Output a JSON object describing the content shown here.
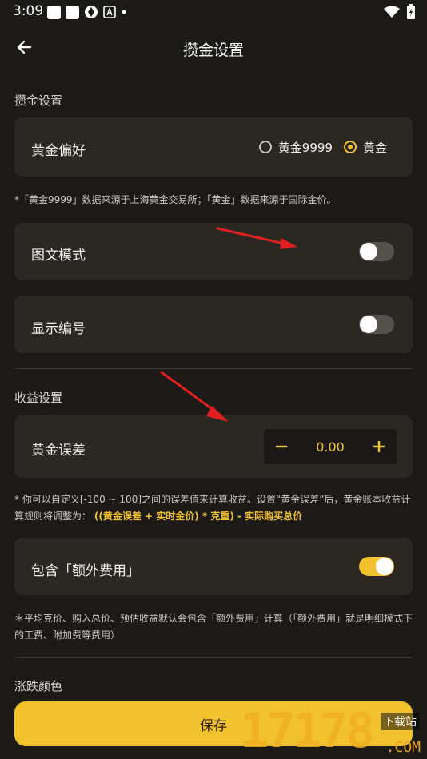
{
  "status_bar": {
    "time": "3:09"
  },
  "header": {
    "title": "攒金设置"
  },
  "section_zanjin": {
    "label": "攒金设置"
  },
  "gold_preference": {
    "label": "黄金偏好",
    "options": [
      "黄金9999",
      "黄金"
    ],
    "selected": "黄金"
  },
  "gold_note": "*「黄金9999」数据来源于上海黄金交易所；「黄金」数据来源于国际金价。",
  "image_text_mode": {
    "label": "图文模式",
    "on": false
  },
  "show_number": {
    "label": "显示编号",
    "on": false
  },
  "section_income": {
    "label": "收益设置"
  },
  "gold_error": {
    "label": "黄金误差",
    "value": "0.00"
  },
  "error_note": {
    "text": "* 你可以自定义[-100 ~ 100]之间的误差值来计算收益。设置“黄金误差”后，黄金账本收益计算规则将调整为：",
    "formula": "((黄金误差 + 实时金价) * 克重) - 实际购买总价"
  },
  "extra_fee": {
    "label": "包含「额外费用」",
    "on": true
  },
  "extra_note": "＊平均克价、购入总价、预估收益默认会包含「额外费用」计算（「额外费用」就是明细模式下的工费、附加费等费用）",
  "section_color": {
    "label": "涨跌颜色"
  },
  "save_button": {
    "label": "保存"
  },
  "watermark": {
    "main": "17178",
    "badge": "下载站",
    "suffix": ".COM"
  },
  "colors": {
    "accent": "#f2c12e",
    "background": "#1c1a17",
    "card": "#2b2824",
    "arrow": "#e02020"
  }
}
